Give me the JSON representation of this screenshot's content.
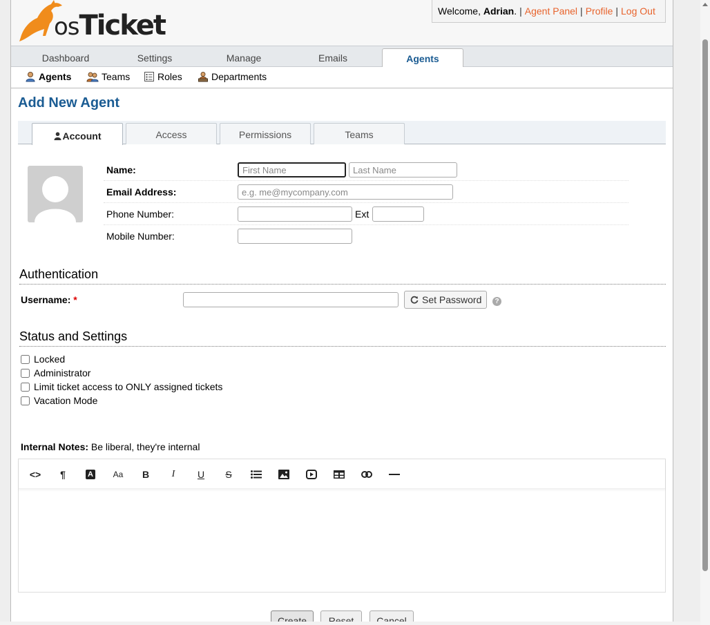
{
  "header": {
    "brand_prefix": "os",
    "brand_suffix": "Ticket",
    "welcome_text": "Welcome, ",
    "user_name": "Adrian",
    "welcome_suffix": ".",
    "links": [
      "Agent Panel",
      "Profile",
      "Log Out"
    ]
  },
  "nav": {
    "tabs": [
      "Dashboard",
      "Settings",
      "Manage",
      "Emails",
      "Agents"
    ],
    "active": "Agents"
  },
  "subnav": {
    "items": [
      "Agents",
      "Teams",
      "Roles",
      "Departments"
    ]
  },
  "page": {
    "title": "Add New Agent"
  },
  "form_tabs": [
    "Account",
    "Access",
    "Permissions",
    "Teams"
  ],
  "account": {
    "name_label": "Name:",
    "first_name_placeholder": "First Name",
    "last_name_placeholder": "Last Name",
    "email_label": "Email Address:",
    "email_placeholder": "e.g. me@mycompany.com",
    "phone_label": "Phone Number:",
    "ext_label": "Ext",
    "mobile_label": "Mobile Number:"
  },
  "auth": {
    "heading": "Authentication",
    "username_label": "Username:",
    "required_mark": "*",
    "set_password_label": "Set Password",
    "help_glyph": "?"
  },
  "status": {
    "heading": "Status and Settings",
    "options": [
      "Locked",
      "Administrator",
      "Limit ticket access to ONLY assigned tickets",
      "Vacation Mode"
    ]
  },
  "notes": {
    "label": "Internal Notes:",
    "hint": "Be liberal, they're internal"
  },
  "editor_toolbar": [
    "code-icon",
    "paragraph-icon",
    "format-icon",
    "font-size-icon",
    "bold-icon",
    "italic-icon",
    "underline-icon",
    "strikethrough-icon",
    "list-icon",
    "image-icon",
    "video-icon",
    "table-icon",
    "link-icon",
    "horizontal-rule-icon"
  ],
  "editor_glyphs": {
    "code": "<>",
    "paragraph": "¶",
    "format": "A",
    "font_size": "Aa",
    "bold": "B",
    "italic": "I",
    "underline": "U",
    "strike": "S"
  },
  "buttons": {
    "create": "Create",
    "reset": "Reset",
    "cancel": "Cancel"
  },
  "colors": {
    "link": "#e8632c",
    "title": "#1b5c93",
    "brand_orange": "#f08c1c"
  }
}
